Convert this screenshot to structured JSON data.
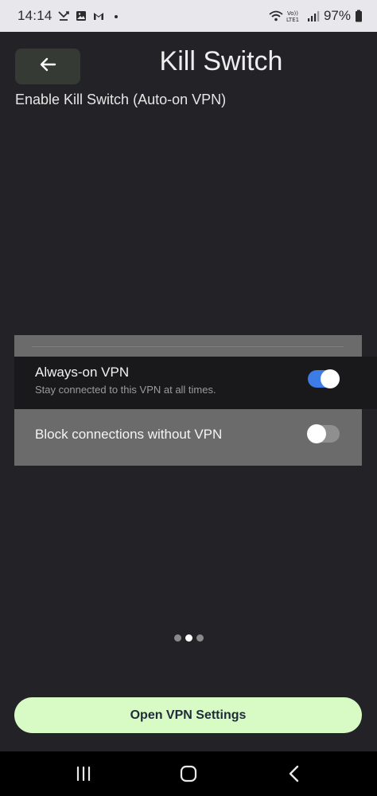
{
  "status_bar": {
    "time": "14:14",
    "icons": [
      "missed-call-icon",
      "image-icon",
      "gmail-icon",
      "dot-icon"
    ],
    "right_icons": [
      "wifi-icon",
      "volte-icon",
      "signal-icon"
    ],
    "battery": "97%"
  },
  "header": {
    "back_icon": "arrow-left-icon",
    "title": "Kill Switch",
    "subtitle": "Enable Kill Switch (Auto-on VPN)"
  },
  "settings": {
    "always_on": {
      "title": "Always-on VPN",
      "description": "Stay connected to this VPN at all times.",
      "enabled": true
    },
    "block": {
      "title": "Block connections without VPN",
      "enabled": false
    }
  },
  "pager": {
    "count": 3,
    "active_index": 1
  },
  "primary_button": {
    "label": "Open VPN Settings"
  },
  "nav": {
    "recents_icon": "recents-icon",
    "home_icon": "home-icon",
    "back_icon": "back-icon"
  },
  "colors": {
    "background": "#232227",
    "accent_toggle": "#3d7be6",
    "button": "#d8fbc5"
  }
}
